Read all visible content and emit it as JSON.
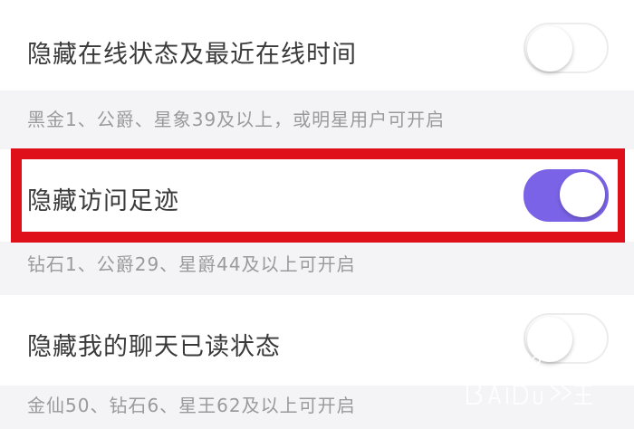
{
  "settings": [
    {
      "label": "隐藏在线状态及最近在线时间",
      "hint": "黑金1、公爵、星象39及以上，或明星用户可开启",
      "enabled": false
    },
    {
      "label": "隐藏访问足迹",
      "hint": "钻石1、公爵29、星爵44及以上可开启",
      "enabled": true
    },
    {
      "label": "隐藏我的聊天已读状态",
      "hint": "金仙50、钻石6、星王62及以上可开启",
      "enabled": false
    }
  ],
  "colors": {
    "toggle_on": "#7b63e8",
    "highlight_border": "#e0101a",
    "watermark": "#ffffff"
  },
  "watermark_icon": "baidu-jingyan-logo"
}
